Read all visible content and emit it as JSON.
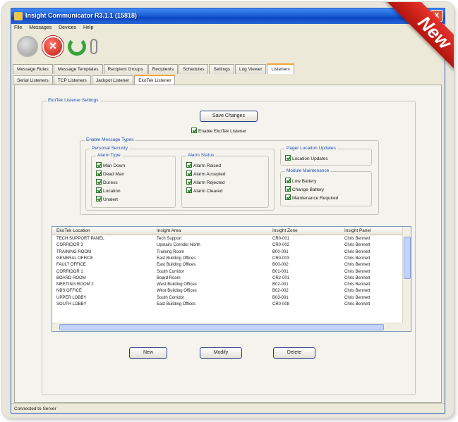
{
  "window": {
    "title": "Insight Communicator R3.1.1 (15818)",
    "close_glyph": "X"
  },
  "menu": [
    "File",
    "Messages",
    "Devices",
    "Help"
  ],
  "toolbar": {
    "icons": [
      "status-icon",
      "stop-icon",
      "refresh-icon",
      "attach-icon"
    ]
  },
  "tabs": [
    "Message Rules",
    "Message Templates",
    "Recipient Groups",
    "Recipients",
    "Schedules",
    "Settings",
    "Log Viewer",
    "Listeners"
  ],
  "active_tab": "Listeners",
  "subtabs": [
    "Serial Listeners",
    "TCP Listeners",
    "Jackpot Listener",
    "EkoTek Listener"
  ],
  "active_subtab": "EkoTek Listener",
  "listener_settings": {
    "group_label": "EkoTek Listener Settings",
    "save_button": "Save Changes",
    "enable_checkbox": "Enable EkoTek Listener",
    "enable_checked": true
  },
  "message_types": {
    "group_label": "Enable Message Types",
    "personal_security": {
      "label": "Personal Security",
      "alarm_type": {
        "label": "Alarm Type",
        "items": [
          "Man Down",
          "Dead Man",
          "Duress",
          "Location",
          "Unalert"
        ]
      },
      "alarm_status": {
        "label": "Alarm Status",
        "items": [
          "Alarm Raised",
          "Alarm Accepted",
          "Alarm Rejected",
          "Alarm Cleared"
        ]
      }
    },
    "pager_location": {
      "label": "Pager Location Updates",
      "items": [
        "Location Updates"
      ]
    },
    "module_maintenance": {
      "label": "Module Maintenance",
      "items": [
        "Low Battery",
        "Change Battery",
        "Maintenance Required"
      ]
    }
  },
  "table": {
    "columns": [
      "EkoTek Location",
      "Insight Area",
      "Insight Zone",
      "Insight Panel"
    ],
    "rows": [
      [
        "TECH SUPPORT PANEL",
        "Tech Support",
        "CR0-001",
        "Chris Bennett"
      ],
      [
        "CORRIDOR 3",
        "Upstairs Corridor North",
        "CR0-002",
        "Chris Bennett"
      ],
      [
        "TRAINING ROOM",
        "Training Room",
        "B00-001",
        "Chris Bennett"
      ],
      [
        "GENERAL OFFICE",
        "East Building Offices",
        "CR0-003",
        "Chris Bennett"
      ],
      [
        "FAULT OFFICE",
        "East Building Offices",
        "B00-002",
        "Chris Bennett"
      ],
      [
        "CORRIDOR 1",
        "South Corridor",
        "B01-001",
        "Chris Bennett"
      ],
      [
        "BOARD ROOM",
        "Board Room",
        "CR2-001",
        "Chris Bennett"
      ],
      [
        "MEETING ROOM 2",
        "West Building Offices",
        "B02-001",
        "Chris Bennett"
      ],
      [
        "NBS OFFICE",
        "West Building Offices",
        "B02-002",
        "Chris Bennett"
      ],
      [
        "UPPER LOBBY",
        "South Corridor",
        "B03-001",
        "Chris Bennett"
      ],
      [
        "SOUTH LOBBY",
        "East Building Offices",
        "CR0-008",
        "Chris Bennett"
      ]
    ]
  },
  "buttons": {
    "new": "New",
    "modify": "Modify",
    "delete": "Delete"
  },
  "status": {
    "text": "Connected to Server"
  },
  "badge": {
    "text": "New",
    "color": "#d7261e"
  }
}
